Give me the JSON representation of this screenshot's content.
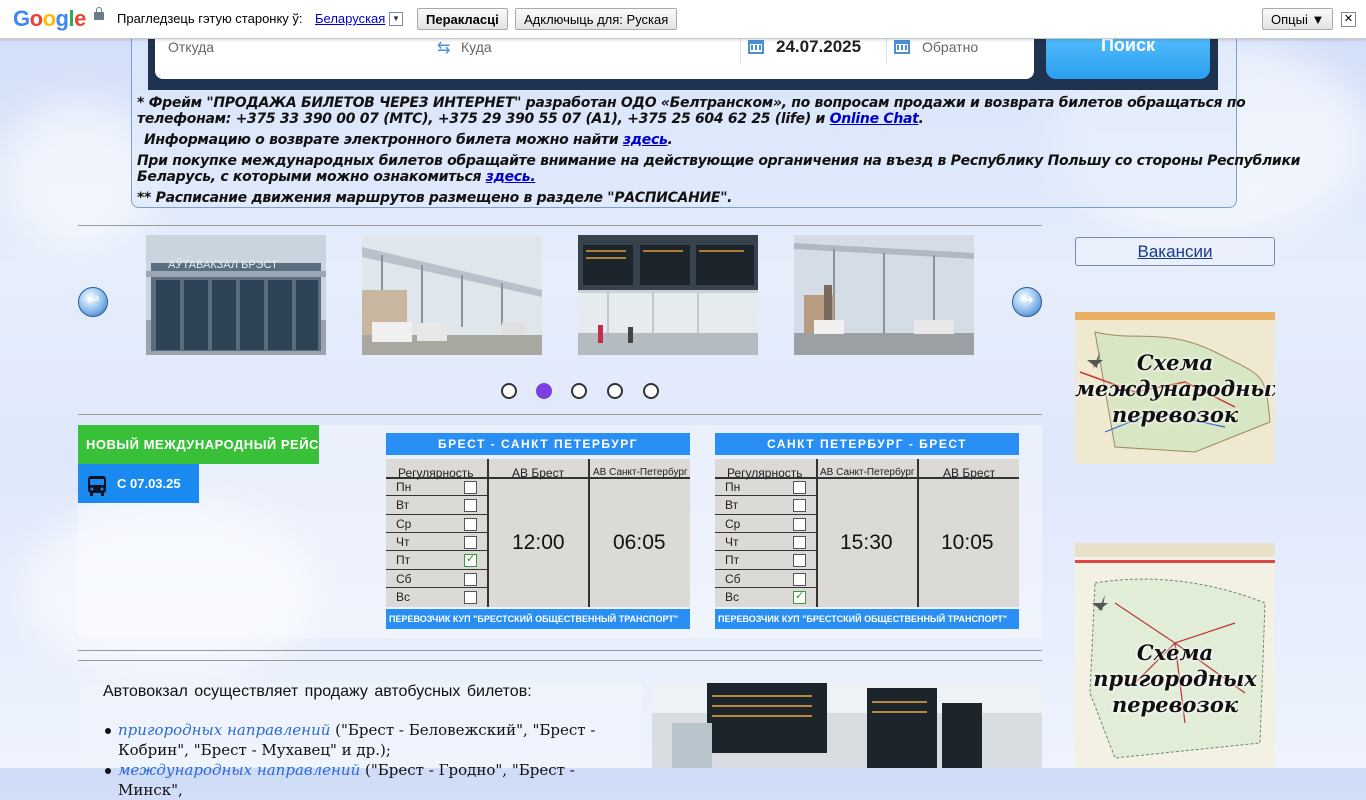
{
  "translate_bar": {
    "logo": [
      "G",
      "o",
      "o",
      "g",
      "l",
      "e"
    ],
    "prompt": "Прагледзець гэтую старонку ў:",
    "language": "Беларуская",
    "translate_button": "Перакласці",
    "disable_button": "Адключыць для: Руская",
    "options_button": "Опцыі ▼",
    "close": "✕"
  },
  "search": {
    "from_placeholder": "Откуда",
    "to_placeholder": "Куда",
    "date": "24.07.2025",
    "return_placeholder": "Обратно",
    "search_button": "Поиск"
  },
  "notes": {
    "line1a": "* Фрейм \"ПРОДАЖА БИЛЕТОВ ЧЕРЕЗ ИНТЕРНЕТ\" разработан ОДО «Белтранском», по вопросам продажи и возврата билетов обращаться по",
    "line1b": "телефонам: +375 33 390 00 07 (МТС), +375 29 390 55 07 (А1), +375 25 604 62 25 (life) и ",
    "online_chat": "Online Chat",
    "line2": "Информацию о возврате электронного билета можно найти ",
    "here1": "здесь",
    "line3a": "При покупке международных билетов обращайте внимание на действующие органичения на въезд в Республику Польшу со стороны Республики",
    "line3b": "Беларусь, с которыми можно ознакомиться ",
    "here2": "здесь.",
    "line4": "** Расписание движения маршрутов размещено в разделе \"РАСПИСАНИЕ\"."
  },
  "slider": {
    "slide1_sign": "АЎТАВАКЗАЛ БРЭСТ",
    "prev": "↩",
    "next": "↪",
    "dots": 5,
    "active_dot": 2
  },
  "sidebar": {
    "vacancies": "Вакансии",
    "map1": [
      "Схема",
      "международных",
      "перевозок"
    ],
    "map2": [
      "Схема",
      "пригородных",
      "перевозок"
    ]
  },
  "route": {
    "tag": "НОВЫЙ МЕЖДУНАРОДНЫЙ РЕЙС",
    "date": "С 07.03.25",
    "tables": [
      {
        "title": "БРЕСТ - САНКТ ПЕТЕРБУРГ",
        "col1": "Регулярность",
        "col2": "АВ Брест",
        "col3": "АВ Санкт-Петербург",
        "days": [
          "Пн",
          "Вт",
          "Ср",
          "Чт",
          "Пт",
          "Сб",
          "Вс"
        ],
        "checked": [
          false,
          false,
          false,
          false,
          true,
          false,
          false
        ],
        "time1": "12:00",
        "time2": "06:05",
        "footer": "ПЕРЕВОЗЧИК  КУП \"БРЕСТСКИЙ ОБЩЕСТВЕННЫЙ ТРАНСПОРТ\""
      },
      {
        "title": "САНКТ ПЕТЕРБУРГ - БРЕСТ",
        "col1": "Регулярность",
        "col2": "АВ Санкт-Петербург",
        "col3": "АВ Брест",
        "days": [
          "Пн",
          "Вт",
          "Ср",
          "Чт",
          "Пт",
          "Сб",
          "Вс"
        ],
        "checked": [
          false,
          false,
          false,
          false,
          false,
          false,
          true
        ],
        "time1": "15:30",
        "time2": "10:05",
        "footer": "ПЕРЕВОЗЧИК  КУП \"БРЕСТСКИЙ ОБЩЕСТВЕННЫЙ ТРАНСПОРТ\""
      }
    ]
  },
  "info": {
    "intro": "Автовокзал осуществляет продажу автобусных билетов:",
    "item1_link": "пригородных направлений",
    "item1_text": " (\"Брест - Беловежский\", \"Брест - Кобрин\", \"Брест - Мухавец\" и др.);",
    "item2_link": "международных направлений",
    "item2_text": " (\"Брест - Гродно\", \"Брест - Минск\","
  }
}
